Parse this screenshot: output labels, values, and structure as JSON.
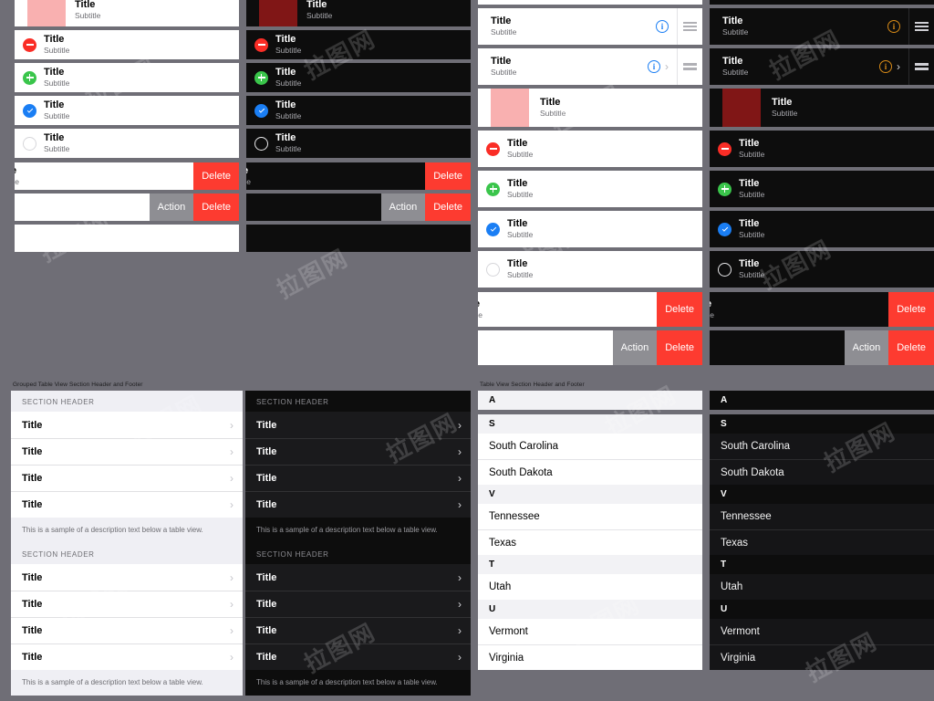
{
  "meta": {
    "background_color": "#6f6e76",
    "accent_blue": "#1a7ef4",
    "accent_orange": "#d98b17",
    "destructive_red": "#fd3b30",
    "action_gray": "#8e8e93",
    "add_green": "#3ac54b",
    "remove_red": "#fa2d26"
  },
  "watermark": {
    "text": "拉图网"
  },
  "labels": {
    "title": "Title",
    "subtitle": "Subtitle",
    "info_glyph": "i",
    "chevron_glyph": "›",
    "delete": "Delete",
    "action": "Action",
    "section_header": "SECTION HEADER",
    "footer_text": "This is a sample of a description text below a table view.",
    "clipped_title": "e",
    "clipped_subtitle": "tle"
  },
  "captions": {
    "grouped": "Grouped Table View Section Header and Footer",
    "plain": "Table View Section Header and Footer"
  },
  "columns": [
    {
      "id": "col1",
      "theme": "light",
      "variant": "plain-cards"
    },
    {
      "id": "col2",
      "theme": "dark",
      "variant": "plain-cards"
    },
    {
      "id": "col3",
      "theme": "light",
      "variant": "accessory-cards"
    },
    {
      "id": "col4",
      "theme": "dark",
      "variant": "accessory-cards"
    }
  ],
  "cell_rows": [
    {
      "name": "image-row",
      "accessory": "thumbnail"
    },
    {
      "name": "remove-row",
      "accessory": "minus-badge"
    },
    {
      "name": "add-row",
      "accessory": "plus-badge"
    },
    {
      "name": "checked-row",
      "accessory": "check-badge"
    },
    {
      "name": "unchecked-row",
      "accessory": "empty-circle"
    }
  ],
  "accessory_rows": [
    {
      "name": "detail-reorder-row",
      "info": true,
      "chevron": false,
      "reorder": "three-line"
    },
    {
      "name": "detail-disclosure-reorder-row",
      "info": true,
      "chevron": true,
      "reorder": "two-line"
    }
  ],
  "swipe_rows": [
    {
      "name": "swipe-delete-row",
      "buttons": [
        "Delete"
      ],
      "clipped": true
    },
    {
      "name": "swipe-action-row",
      "buttons": [
        "Action",
        "Delete"
      ],
      "clipped": false
    }
  ],
  "grouped_table": {
    "sections": [
      {
        "header": "SECTION HEADER",
        "rows": [
          "Title",
          "Title",
          "Title",
          "Title"
        ],
        "footer": "This is a sample of a description text below a table view."
      },
      {
        "header": "SECTION HEADER",
        "rows": [
          "Title",
          "Title",
          "Title",
          "Title"
        ],
        "footer": "This is a sample of a description text below a table view."
      }
    ]
  },
  "indexed_list": {
    "top_section": "A",
    "sections": [
      {
        "index": "S",
        "items": [
          "South Carolina",
          "South Dakota"
        ]
      },
      {
        "index": "V",
        "items": [
          "Tennessee",
          "Texas"
        ]
      },
      {
        "index": "T",
        "items": [
          "Utah"
        ]
      },
      {
        "index": "U",
        "items": [
          "Vermont",
          "Virginia"
        ]
      }
    ]
  }
}
